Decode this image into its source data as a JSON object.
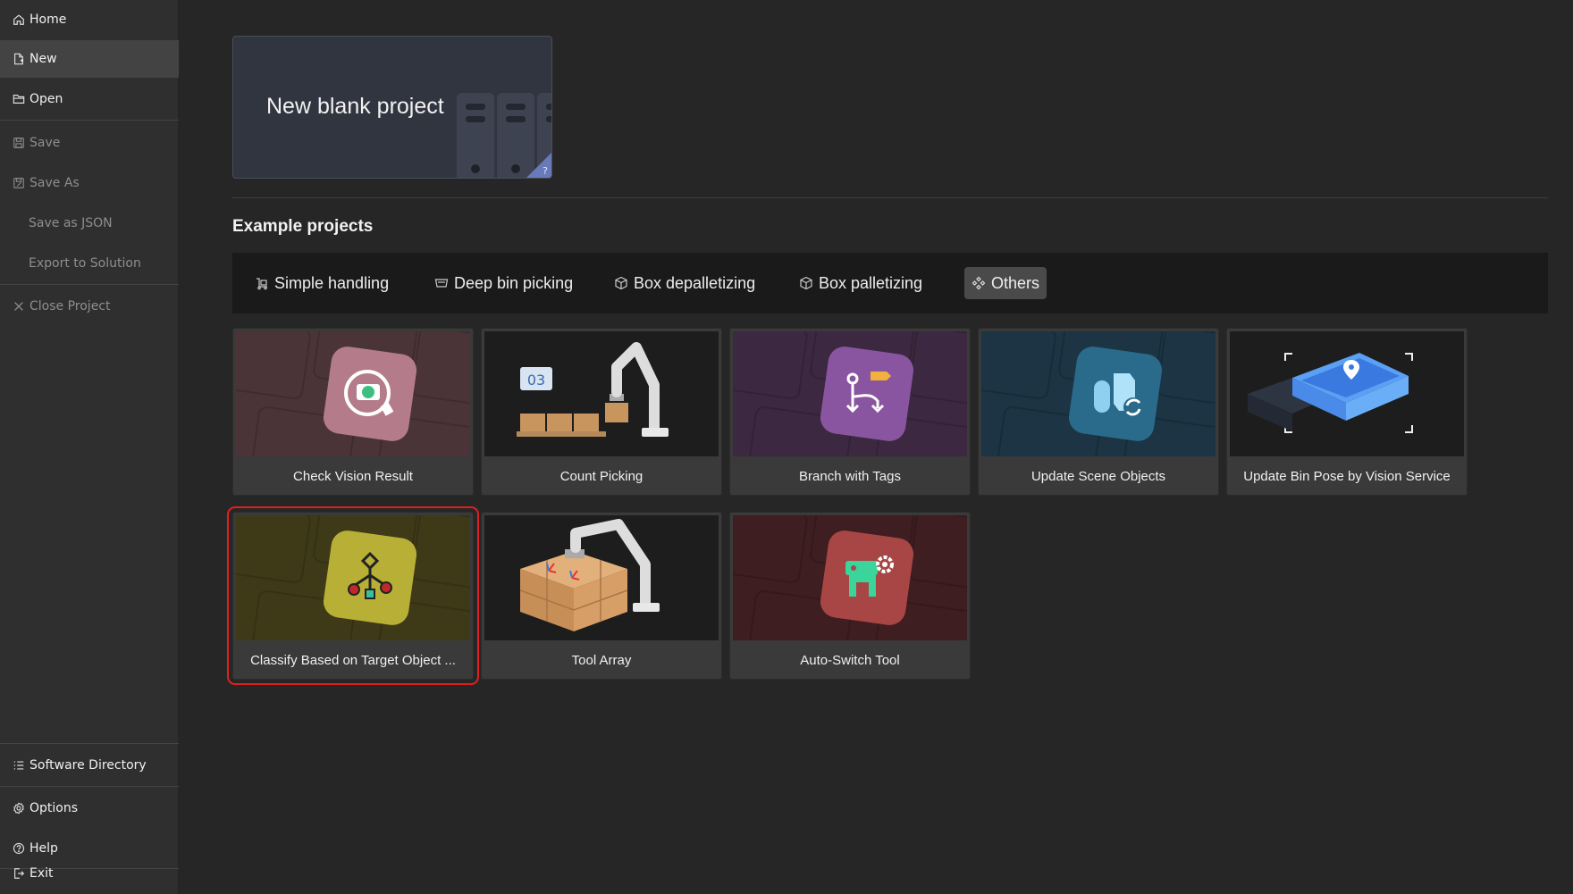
{
  "sidebar": {
    "items": [
      {
        "label": "Home",
        "icon": "home-icon"
      },
      {
        "label": "New",
        "icon": "new-file-icon"
      },
      {
        "label": "Open",
        "icon": "folder-open-icon"
      },
      {
        "label": "Save",
        "icon": "save-icon"
      },
      {
        "label": "Save As",
        "icon": "save-as-icon"
      },
      {
        "label": "Save as JSON"
      },
      {
        "label": "Export to Solution"
      },
      {
        "label": "Close Project",
        "icon": "close-icon"
      },
      {
        "label": "Software Directory",
        "icon": "list-icon"
      },
      {
        "label": "Options",
        "icon": "gear-icon"
      },
      {
        "label": "Help",
        "icon": "help-icon"
      },
      {
        "label": "Exit",
        "icon": "exit-icon"
      }
    ]
  },
  "new_project": {
    "title": "New blank project",
    "help": "?"
  },
  "examples": {
    "title": "Example projects",
    "tabs": [
      {
        "label": "Simple handling",
        "icon": "handling-icon"
      },
      {
        "label": "Deep bin picking",
        "icon": "bin-icon"
      },
      {
        "label": "Box depalletizing",
        "icon": "box-icon"
      },
      {
        "label": "Box palletizing",
        "icon": "box-icon"
      },
      {
        "label": "Others",
        "icon": "others-icon",
        "active": true
      }
    ],
    "cards": [
      {
        "label": "Check Vision Result",
        "color": "#a56a7a"
      },
      {
        "label": "Count Picking",
        "counter": "03"
      },
      {
        "label": "Branch with Tags",
        "color": "#8a55a0"
      },
      {
        "label": "Update Scene Objects",
        "color": "#2a6a8a"
      },
      {
        "label": "Update Bin Pose by Vision Service",
        "color": "#4a8ae8"
      },
      {
        "label": "Classify Based on Target Object ...",
        "color": "#b8b036",
        "selected": true
      },
      {
        "label": "Tool Array"
      },
      {
        "label": "Auto-Switch Tool",
        "color": "#a84646"
      }
    ]
  }
}
